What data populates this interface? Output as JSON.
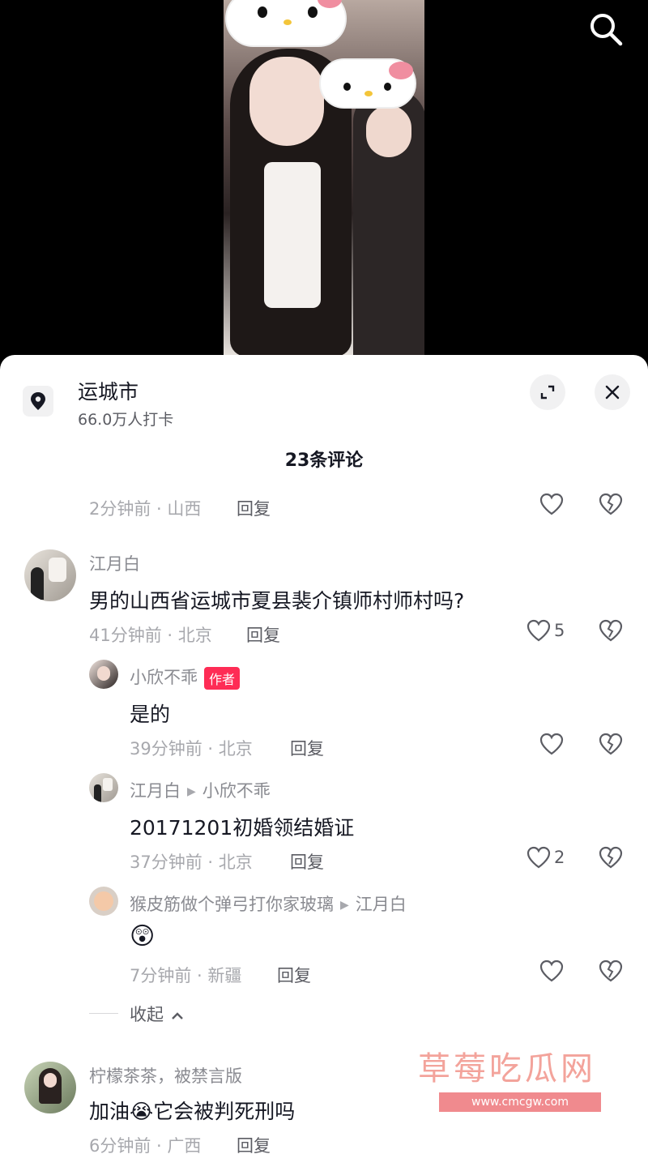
{
  "location": {
    "name": "运城市",
    "checkins": "66.0万人打卡"
  },
  "comments_title": "23条评论",
  "reply_label": "回复",
  "collapse_label": "收起",
  "top_partial": {
    "meta": "2分钟前 · 山西"
  },
  "comment1": {
    "user": "江月白",
    "text": "男的山西省运城市夏县裴介镇师村师村吗?",
    "meta": "41分钟前 · 北京",
    "likes": "5"
  },
  "reply1": {
    "user": "小欣不乖",
    "badge": "作者",
    "text": "是的",
    "meta": "39分钟前 · 北京"
  },
  "reply2": {
    "user": "江月白",
    "to": "小欣不乖",
    "text": "20171201初婚领结婚证",
    "meta": "37分钟前 · 北京",
    "likes": "2"
  },
  "reply3": {
    "user": "猴皮筋做个弹弓打你家玻璃",
    "to": "江月白",
    "emoji": "😲",
    "meta": "7分钟前 · 新疆"
  },
  "comment2": {
    "user": "柠檬茶茶，被禁言版",
    "text_a": "加油",
    "emoji": "😭",
    "text_b": "它会被判死刑吗",
    "meta": "6分钟前 · 广西"
  },
  "watermark": {
    "title": "草莓吃瓜网",
    "url": "www.cmcgw.com"
  },
  "colors": {
    "accent": "#fe2c55",
    "text": "#161823",
    "muted": "#a7a8ad"
  }
}
